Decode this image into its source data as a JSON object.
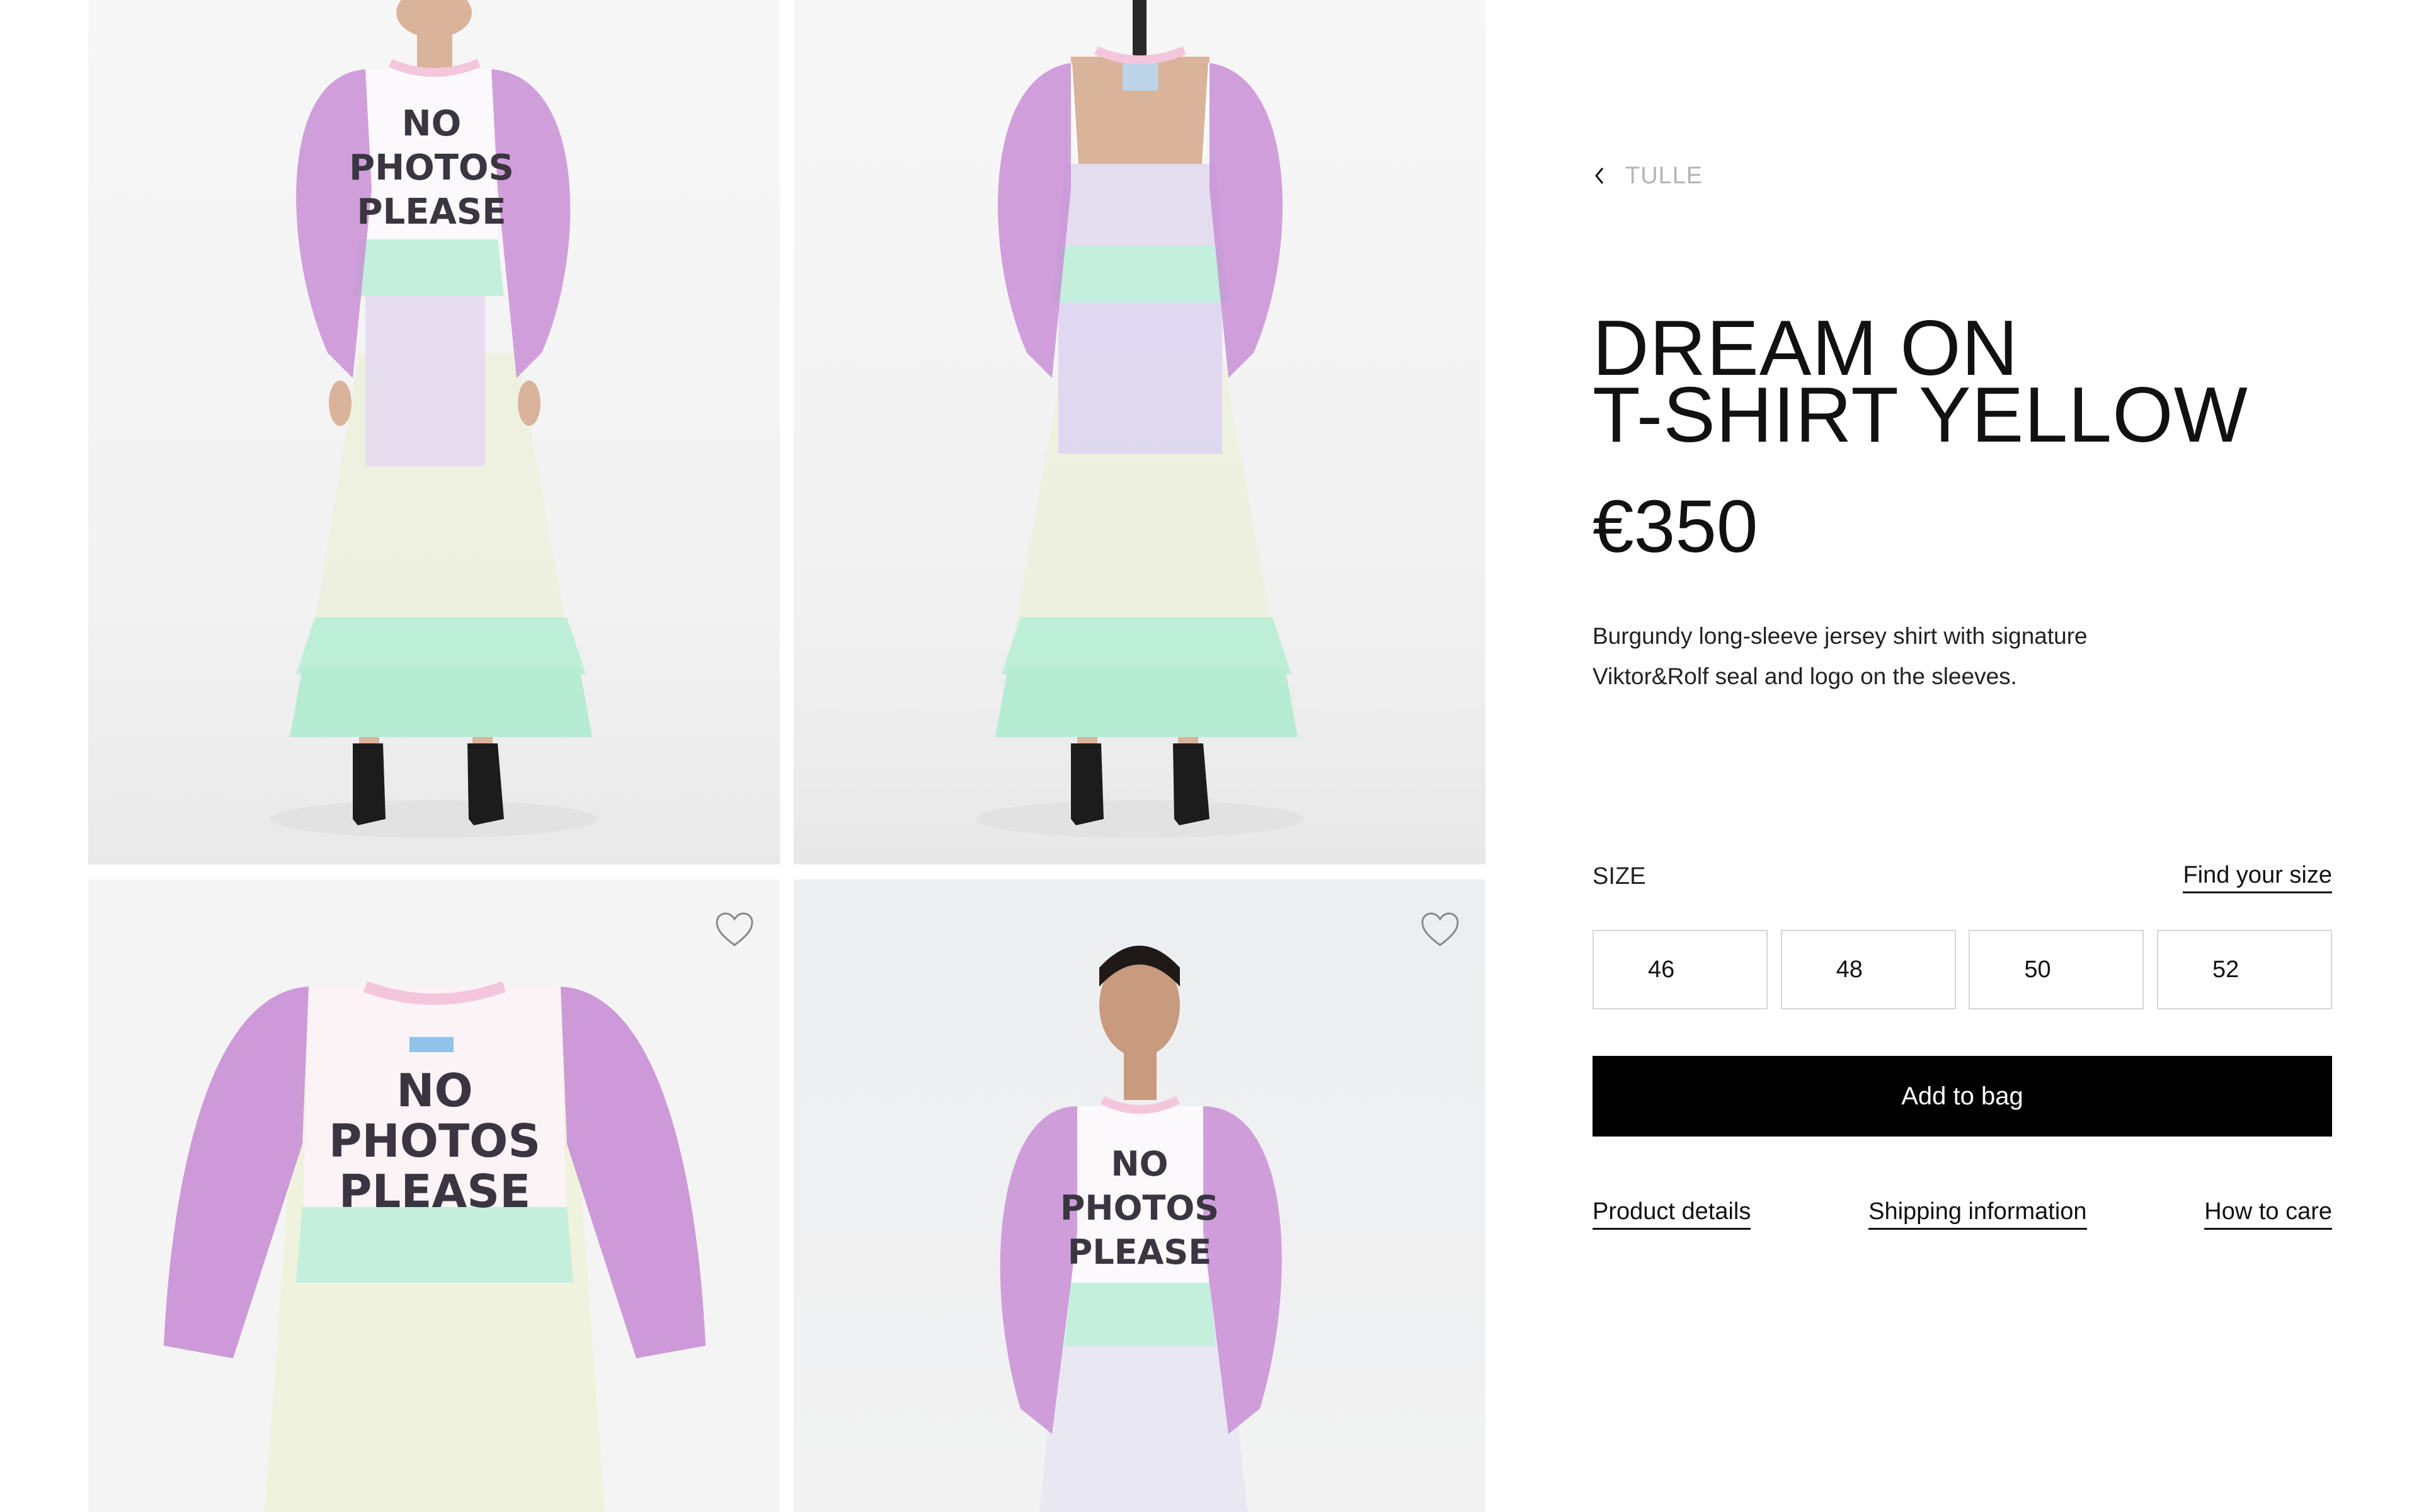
{
  "gallery": {
    "images": [
      {
        "name": "model-front",
        "print_lines": [
          "NO",
          "PHOTOS",
          "PLEASE"
        ]
      },
      {
        "name": "model-back"
      },
      {
        "name": "flat-lay",
        "print_lines": [
          "NO",
          "PHOTOS",
          "PLEASE"
        ]
      },
      {
        "name": "model-front-closeup",
        "print_lines": [
          "NO",
          "PHOTOS",
          "PLEASE"
        ]
      }
    ],
    "favorite_icon": "heart-icon"
  },
  "breadcrumb": {
    "icon": "chevron-left-icon",
    "label": "TULLE"
  },
  "product": {
    "title_line1": "DREAM ON",
    "title_line2": "T-SHIRT YELLOW",
    "price": "€350",
    "description": "Burgundy long-sleeve jersey shirt with signature Viktor&Rolf seal and logo on the sleeves."
  },
  "size": {
    "label": "SIZE",
    "find_label": "Find your size",
    "options": [
      "46",
      "48",
      "50",
      "52"
    ]
  },
  "actions": {
    "add_to_bag": "Add to bag"
  },
  "info_links": {
    "product_details": "Product details",
    "shipping": "Shipping information",
    "care": "How to care"
  },
  "colors": {
    "accent": "#000000",
    "breadcrumb": "#b4b4b4",
    "tulle_pink": "#c98fd6",
    "tulle_mint": "#b9ebd6",
    "tulle_cream": "#ecf0dc"
  }
}
